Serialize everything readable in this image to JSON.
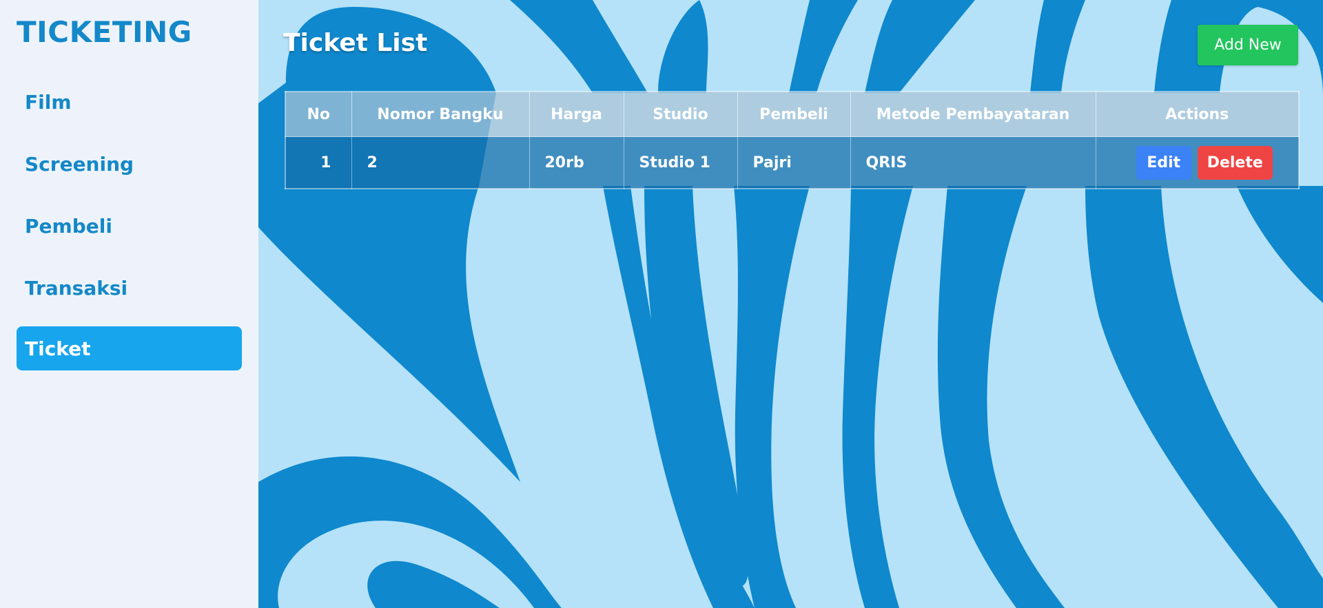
{
  "sidebar": {
    "brand": "TICKETING",
    "items": [
      {
        "label": "Film",
        "active": false
      },
      {
        "label": "Screening",
        "active": false
      },
      {
        "label": "Pembeli",
        "active": false
      },
      {
        "label": "Transaksi",
        "active": false
      },
      {
        "label": "Ticket",
        "active": true
      }
    ]
  },
  "main": {
    "title": "Ticket List",
    "add_label": "Add New",
    "table": {
      "headers": [
        "No",
        "Nomor Bangku",
        "Harga",
        "Studio",
        "Pembeli",
        "Metode Pembayataran",
        "Actions"
      ],
      "rows": [
        {
          "no": "1",
          "nomor_bangku": "2",
          "harga": "20rb",
          "studio": "Studio 1",
          "pembeli": "Pajri",
          "metode": "QRIS",
          "edit_label": "Edit",
          "delete_label": "Delete"
        }
      ]
    }
  },
  "colors": {
    "brand": "#1488c8",
    "active_nav": "#17a5ee",
    "add_button": "#22c55e",
    "edit_button": "#3b82f6",
    "delete_button": "#ef4444",
    "background_light": "#b5e2f8",
    "background_dark": "#0f88cd"
  }
}
